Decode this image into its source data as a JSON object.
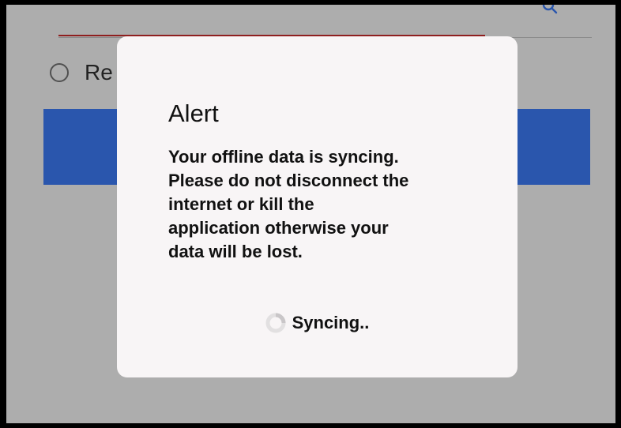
{
  "background": {
    "radio_label": "Re",
    "accent_color": "#3f7fff",
    "underline_color": "#d32f2f",
    "icon": "search-icon"
  },
  "alert": {
    "title": "Alert",
    "message": "Your offline data is syncing.\nPlease do not disconnect the\ninternet or kill the\napplication otherwise your\ndata will be lost.",
    "status_icon": "spinner-icon",
    "status_text": "Syncing.."
  }
}
